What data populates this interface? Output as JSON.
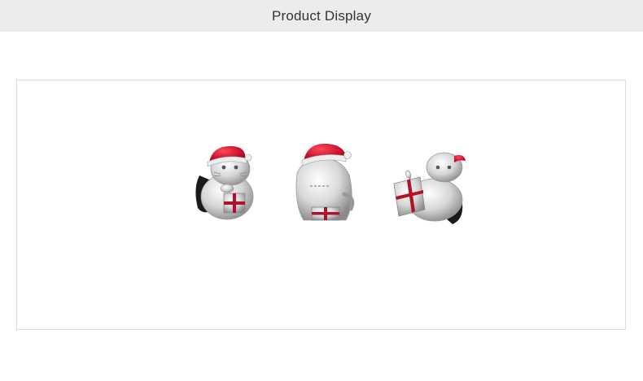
{
  "header": {
    "title": "Product Display"
  },
  "products": [
    {
      "icon": "santa-cat-charm-front-image"
    },
    {
      "icon": "santa-cat-charm-back-image"
    },
    {
      "icon": "santa-cat-charm-lying-image"
    }
  ],
  "colors": {
    "header_background": "#ececec",
    "frame_border": "#dcdcdc",
    "hat_red": "#c8102e",
    "silver": "#d9d9d9",
    "enamel_black": "#1a1a1a"
  }
}
